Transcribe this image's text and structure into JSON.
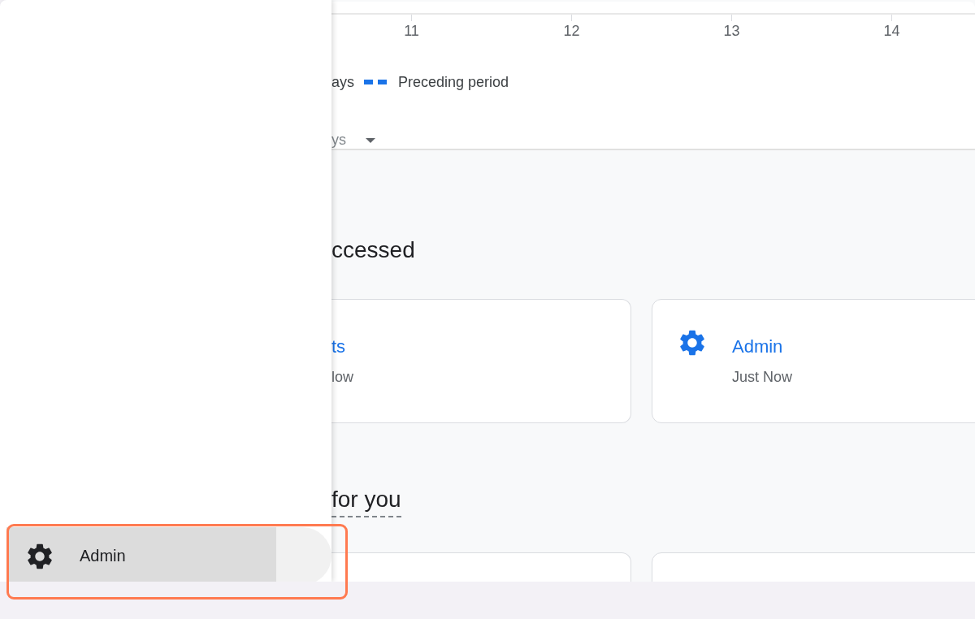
{
  "chart": {
    "x_ticks": [
      "11",
      "12",
      "13",
      "14"
    ]
  },
  "legend": [
    {
      "label": "ays",
      "kind": "text"
    },
    {
      "label": "Preceding period",
      "kind": "dashed"
    }
  ],
  "range_dropdown": {
    "value": "ys"
  },
  "sections": [
    {
      "title": "ccessed",
      "underlined": false,
      "cards": [
        {
          "kind": "link",
          "title": "ts",
          "subtitle": "low"
        },
        {
          "kind": "gear",
          "title": "Admin",
          "subtitle": "Just Now"
        }
      ]
    },
    {
      "title": "for you",
      "underlined": true,
      "cards": [
        {
          "kind": "blank"
        },
        {
          "kind": "blank"
        }
      ]
    }
  ],
  "drawer": {
    "items": [
      {
        "label": "Admin",
        "selected": true
      }
    ]
  },
  "highlight": {
    "on": true
  }
}
